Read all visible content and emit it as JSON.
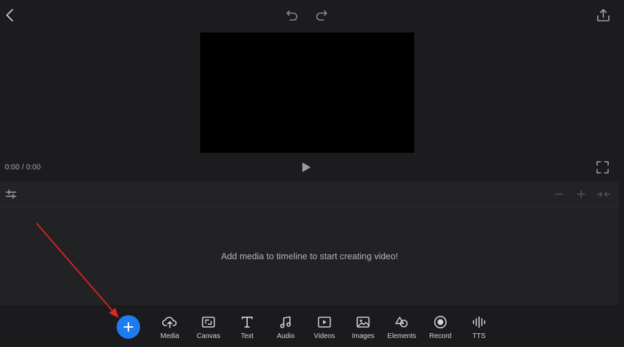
{
  "player": {
    "time_readout": "0:00 / 0:00"
  },
  "timeline": {
    "empty_message": "Add media to timeline to start creating video!"
  },
  "toolbar": {
    "items": [
      {
        "label": "Media",
        "icon": "cloud-upload-icon"
      },
      {
        "label": "Canvas",
        "icon": "canvas-resize-icon"
      },
      {
        "label": "Text",
        "icon": "text-icon"
      },
      {
        "label": "Audio",
        "icon": "music-note-icon"
      },
      {
        "label": "Videos",
        "icon": "video-play-icon"
      },
      {
        "label": "Images",
        "icon": "image-icon"
      },
      {
        "label": "Elements",
        "icon": "shapes-icon"
      },
      {
        "label": "Record",
        "icon": "record-icon"
      },
      {
        "label": "TTS",
        "icon": "waveform-icon"
      }
    ]
  },
  "colors": {
    "accent": "#1e7cf2",
    "annotation_arrow": "#e02424",
    "background": "#1c1c1f"
  }
}
